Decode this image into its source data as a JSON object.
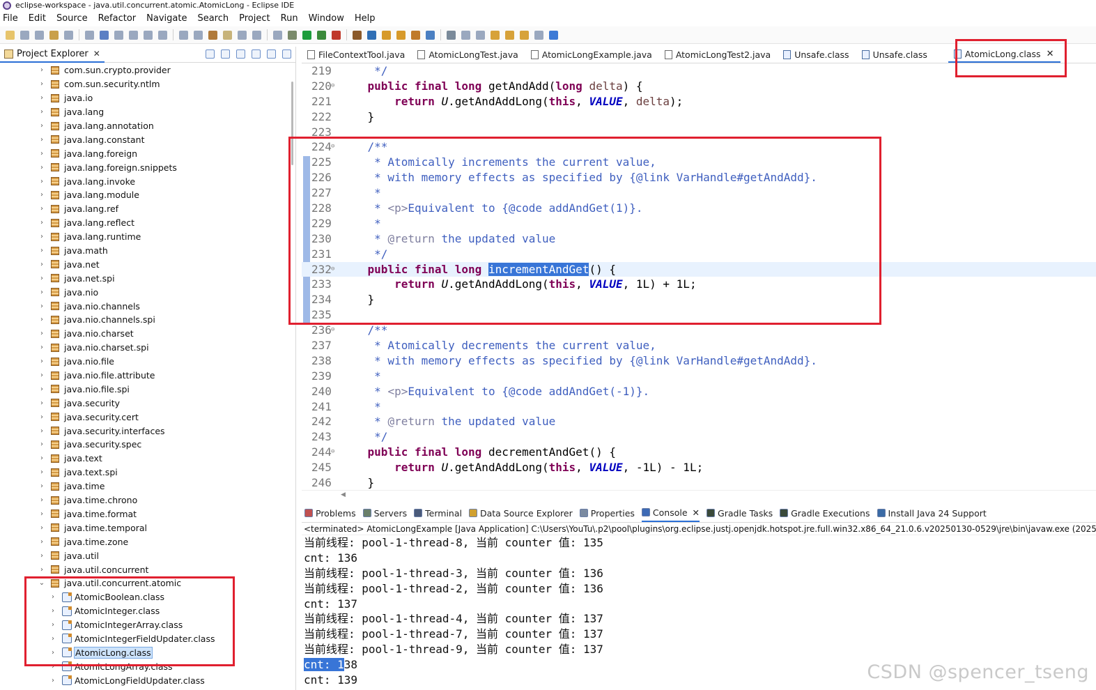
{
  "window": {
    "title": "eclipse-workspace - java.util.concurrent.atomic.AtomicLong - Eclipse IDE"
  },
  "menubar": [
    "File",
    "Edit",
    "Source",
    "Refactor",
    "Navigate",
    "Search",
    "Project",
    "Run",
    "Window",
    "Help"
  ],
  "project_explorer": {
    "title": "Project Explorer",
    "items": [
      {
        "label": "com.sun.crypto.provider",
        "kind": "package"
      },
      {
        "label": "com.sun.security.ntlm",
        "kind": "package"
      },
      {
        "label": "java.io",
        "kind": "package"
      },
      {
        "label": "java.lang",
        "kind": "package"
      },
      {
        "label": "java.lang.annotation",
        "kind": "package"
      },
      {
        "label": "java.lang.constant",
        "kind": "package"
      },
      {
        "label": "java.lang.foreign",
        "kind": "package"
      },
      {
        "label": "java.lang.foreign.snippets",
        "kind": "package"
      },
      {
        "label": "java.lang.invoke",
        "kind": "package"
      },
      {
        "label": "java.lang.module",
        "kind": "package"
      },
      {
        "label": "java.lang.ref",
        "kind": "package"
      },
      {
        "label": "java.lang.reflect",
        "kind": "package"
      },
      {
        "label": "java.lang.runtime",
        "kind": "package"
      },
      {
        "label": "java.math",
        "kind": "package"
      },
      {
        "label": "java.net",
        "kind": "package"
      },
      {
        "label": "java.net.spi",
        "kind": "package"
      },
      {
        "label": "java.nio",
        "kind": "package"
      },
      {
        "label": "java.nio.channels",
        "kind": "package"
      },
      {
        "label": "java.nio.channels.spi",
        "kind": "package"
      },
      {
        "label": "java.nio.charset",
        "kind": "package"
      },
      {
        "label": "java.nio.charset.spi",
        "kind": "package"
      },
      {
        "label": "java.nio.file",
        "kind": "package"
      },
      {
        "label": "java.nio.file.attribute",
        "kind": "package"
      },
      {
        "label": "java.nio.file.spi",
        "kind": "package"
      },
      {
        "label": "java.security",
        "kind": "package"
      },
      {
        "label": "java.security.cert",
        "kind": "package"
      },
      {
        "label": "java.security.interfaces",
        "kind": "package"
      },
      {
        "label": "java.security.spec",
        "kind": "package"
      },
      {
        "label": "java.text",
        "kind": "package"
      },
      {
        "label": "java.text.spi",
        "kind": "package"
      },
      {
        "label": "java.time",
        "kind": "package"
      },
      {
        "label": "java.time.chrono",
        "kind": "package"
      },
      {
        "label": "java.time.format",
        "kind": "package"
      },
      {
        "label": "java.time.temporal",
        "kind": "package"
      },
      {
        "label": "java.time.zone",
        "kind": "package"
      },
      {
        "label": "java.util",
        "kind": "package"
      },
      {
        "label": "java.util.concurrent",
        "kind": "package"
      },
      {
        "label": "java.util.concurrent.atomic",
        "kind": "package",
        "expanded": true
      },
      {
        "label": "AtomicBoolean.class",
        "kind": "class"
      },
      {
        "label": "AtomicInteger.class",
        "kind": "class"
      },
      {
        "label": "AtomicIntegerArray.class",
        "kind": "class"
      },
      {
        "label": "AtomicIntegerFieldUpdater.class",
        "kind": "class"
      },
      {
        "label": "AtomicLong.class",
        "kind": "class",
        "selected": true
      },
      {
        "label": "AtomicLongArray.class",
        "kind": "class"
      },
      {
        "label": "AtomicLongFieldUpdater.class",
        "kind": "class"
      }
    ]
  },
  "editor": {
    "tabs": [
      {
        "label": "FileContextTool.java",
        "kind": "java"
      },
      {
        "label": "AtomicLongTest.java",
        "kind": "java"
      },
      {
        "label": "AtomicLongExample.java",
        "kind": "java"
      },
      {
        "label": "AtomicLongTest2.java",
        "kind": "java"
      },
      {
        "label": "Unsafe.class",
        "kind": "class"
      },
      {
        "label": "Unsafe.class",
        "kind": "class"
      },
      {
        "label": "AtomicLong.class",
        "kind": "class",
        "active": true
      }
    ],
    "lines": [
      {
        "n": "219",
        "tokens": [
          [
            "cm",
            "     */"
          ]
        ]
      },
      {
        "n": "220",
        "fold": true,
        "tokens": [
          [
            "tx",
            "    "
          ],
          [
            "kw",
            "public"
          ],
          [
            "tx",
            " "
          ],
          [
            "kw",
            "final"
          ],
          [
            "tx",
            " "
          ],
          [
            "kw",
            "long"
          ],
          [
            "tx",
            " getAndAdd("
          ],
          [
            "kw",
            "long"
          ],
          [
            "tx",
            " "
          ],
          [
            "pr",
            "delta"
          ],
          [
            "tx",
            ") {"
          ]
        ]
      },
      {
        "n": "221",
        "tokens": [
          [
            "tx",
            "        "
          ],
          [
            "kw",
            "return"
          ],
          [
            "tx",
            " "
          ],
          [
            "st",
            "U"
          ],
          [
            "tx",
            ".getAndAddLong("
          ],
          [
            "kw",
            "this"
          ],
          [
            "tx",
            ", "
          ],
          [
            "sf",
            "VALUE"
          ],
          [
            "tx",
            ", "
          ],
          [
            "pr",
            "delta"
          ],
          [
            "tx",
            ");"
          ]
        ]
      },
      {
        "n": "222",
        "tokens": [
          [
            "tx",
            "    }"
          ]
        ]
      },
      {
        "n": "223",
        "tokens": []
      },
      {
        "n": "224",
        "fold": true,
        "tokens": [
          [
            "cm",
            "    /**"
          ]
        ]
      },
      {
        "n": "225",
        "tokens": [
          [
            "cm",
            "     * Atomically increments the current value,"
          ]
        ]
      },
      {
        "n": "226",
        "tokens": [
          [
            "cm",
            "     * with memory effects as specified by {@link VarHandle#getAndAdd}."
          ]
        ]
      },
      {
        "n": "227",
        "tokens": [
          [
            "cm",
            "     *"
          ]
        ]
      },
      {
        "n": "228",
        "tokens": [
          [
            "cm",
            "     * "
          ],
          [
            "tg",
            "<p>"
          ],
          [
            "cm",
            "Equivalent to {@code addAndGet(1)}."
          ]
        ]
      },
      {
        "n": "229",
        "tokens": [
          [
            "cm",
            "     *"
          ]
        ]
      },
      {
        "n": "230",
        "tokens": [
          [
            "cm",
            "     * "
          ],
          [
            "tg",
            "@return"
          ],
          [
            "cm",
            " the updated value"
          ]
        ]
      },
      {
        "n": "231",
        "tokens": [
          [
            "cm",
            "     */"
          ]
        ]
      },
      {
        "n": "232",
        "fold": true,
        "current": true,
        "tokens": [
          [
            "tx",
            "    "
          ],
          [
            "kw",
            "public"
          ],
          [
            "tx",
            " "
          ],
          [
            "kw",
            "final"
          ],
          [
            "tx",
            " "
          ],
          [
            "kw",
            "long"
          ],
          [
            "tx",
            " "
          ],
          [
            "sel",
            "incrementAndGet"
          ],
          [
            "tx",
            "() {"
          ]
        ]
      },
      {
        "n": "233",
        "tokens": [
          [
            "tx",
            "        "
          ],
          [
            "kw",
            "return"
          ],
          [
            "tx",
            " "
          ],
          [
            "st",
            "U"
          ],
          [
            "tx",
            ".getAndAddLong("
          ],
          [
            "kw",
            "this"
          ],
          [
            "tx",
            ", "
          ],
          [
            "sf",
            "VALUE"
          ],
          [
            "tx",
            ", 1L) + 1L;"
          ]
        ]
      },
      {
        "n": "234",
        "tokens": [
          [
            "tx",
            "    }"
          ]
        ]
      },
      {
        "n": "235",
        "tokens": []
      },
      {
        "n": "236",
        "fold": true,
        "tokens": [
          [
            "cm",
            "    /**"
          ]
        ]
      },
      {
        "n": "237",
        "tokens": [
          [
            "cm",
            "     * Atomically decrements the current value,"
          ]
        ]
      },
      {
        "n": "238",
        "tokens": [
          [
            "cm",
            "     * with memory effects as specified by {@link VarHandle#getAndAdd}."
          ]
        ]
      },
      {
        "n": "239",
        "tokens": [
          [
            "cm",
            "     *"
          ]
        ]
      },
      {
        "n": "240",
        "tokens": [
          [
            "cm",
            "     * "
          ],
          [
            "tg",
            "<p>"
          ],
          [
            "cm",
            "Equivalent to {@code addAndGet(-1)}."
          ]
        ]
      },
      {
        "n": "241",
        "tokens": [
          [
            "cm",
            "     *"
          ]
        ]
      },
      {
        "n": "242",
        "tokens": [
          [
            "cm",
            "     * "
          ],
          [
            "tg",
            "@return"
          ],
          [
            "cm",
            " the updated value"
          ]
        ]
      },
      {
        "n": "243",
        "tokens": [
          [
            "cm",
            "     */"
          ]
        ]
      },
      {
        "n": "244",
        "fold": true,
        "tokens": [
          [
            "tx",
            "    "
          ],
          [
            "kw",
            "public"
          ],
          [
            "tx",
            " "
          ],
          [
            "kw",
            "final"
          ],
          [
            "tx",
            " "
          ],
          [
            "kw",
            "long"
          ],
          [
            "tx",
            " decrementAndGet() {"
          ]
        ]
      },
      {
        "n": "245",
        "tokens": [
          [
            "tx",
            "        "
          ],
          [
            "kw",
            "return"
          ],
          [
            "tx",
            " "
          ],
          [
            "st",
            "U"
          ],
          [
            "tx",
            ".getAndAddLong("
          ],
          [
            "kw",
            "this"
          ],
          [
            "tx",
            ", "
          ],
          [
            "sf",
            "VALUE"
          ],
          [
            "tx",
            ", -1L) - 1L;"
          ]
        ]
      },
      {
        "n": "246",
        "tokens": [
          [
            "tx",
            "    }"
          ]
        ]
      }
    ]
  },
  "console": {
    "tabs": [
      {
        "label": "Problems"
      },
      {
        "label": "Servers"
      },
      {
        "label": "Terminal"
      },
      {
        "label": "Data Source Explorer"
      },
      {
        "label": "Properties"
      },
      {
        "label": "Console",
        "active": true
      },
      {
        "label": "Gradle Tasks"
      },
      {
        "label": "Gradle Executions"
      },
      {
        "label": "Install Java 24 Support"
      }
    ],
    "terminated": "<terminated> AtomicLongExample [Java Application] C:\\Users\\YouTu\\.p2\\pool\\plugins\\org.eclipse.justj.openjdk.hotspot.jre.full.win32.x86_64_21.0.6.v20250130-0529\\jre\\bin\\javaw.exe  (2025年4月8日",
    "lines": [
      "当前线程: pool-1-thread-8, 当前 counter 值: 135",
      "cnt: 136",
      "当前线程: pool-1-thread-3, 当前 counter 值: 136",
      "当前线程: pool-1-thread-2, 当前 counter 值: 136",
      "cnt: 137",
      "当前线程: pool-1-thread-4, 当前 counter 值: 137",
      "当前线程: pool-1-thread-7, 当前 counter 值: 137",
      "当前线程: pool-1-thread-9, 当前 counter 值: 137",
      "cnt: 138",
      "cnt: 139"
    ],
    "highlighted_prefix": "cnt: 1"
  },
  "watermark": "CSDN @spencer_tseng",
  "colors": {
    "annotation_box": "#e0202f",
    "selection": "#3875d7",
    "keyword": "#7f0055",
    "comment": "#3f5fbf",
    "field": "#0000c0"
  }
}
